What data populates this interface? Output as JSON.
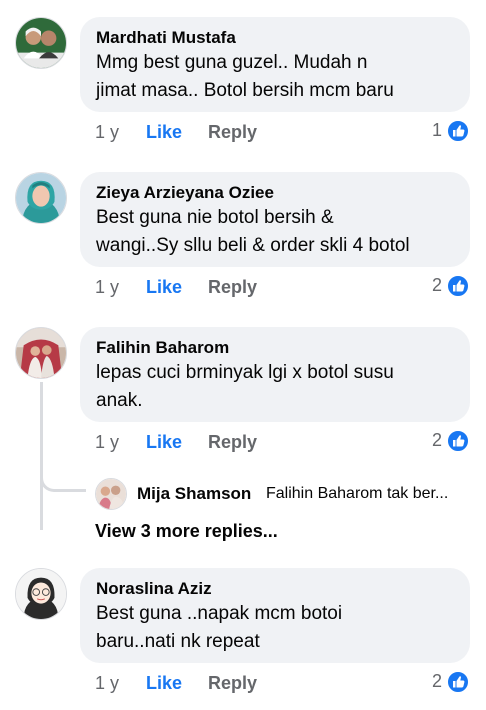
{
  "colors": {
    "link_blue": "#1877f2",
    "meta_gray": "#65676b",
    "bubble_bg": "#f0f2f5"
  },
  "comments": [
    {
      "author": "Mardhati Mustafa",
      "text": "Mmg best guna guzel.. Mudah n\njimat masa.. Botol bersih mcm baru",
      "time": "1 y",
      "like": "Like",
      "reply": "Reply",
      "reactions": "1",
      "avatar_icon": "profile-photo-couple"
    },
    {
      "author": "Zieya Arzieyana Oziee",
      "text": "Best guna nie botol bersih &\nwangi..Sy sllu beli & order skli 4 botol",
      "time": "1 y",
      "like": "Like",
      "reply": "Reply",
      "reactions": "2",
      "avatar_icon": "profile-photo-woman-hijab"
    },
    {
      "author": "Falihin Baharom",
      "text": "lepas cuci brminyak lgi x botol susu\nanak.",
      "time": "1 y",
      "like": "Like",
      "reply": "Reply",
      "reactions": "2",
      "avatar_icon": "profile-photo-wedding"
    },
    {
      "author": "Noraslina Aziz",
      "text": "Best guna ..napak mcm botoi\nbaru..nati nk repeat",
      "time": "1 y",
      "like": "Like",
      "reply": "Reply",
      "reactions": "2",
      "avatar_icon": "profile-photo-cartoon-hijab"
    }
  ],
  "reply_preview": {
    "author": "Mija Shamson",
    "text": "Falihin Baharom tak ber...",
    "avatar_icon": "profile-photo-group"
  },
  "view_more": "View 3 more replies..."
}
